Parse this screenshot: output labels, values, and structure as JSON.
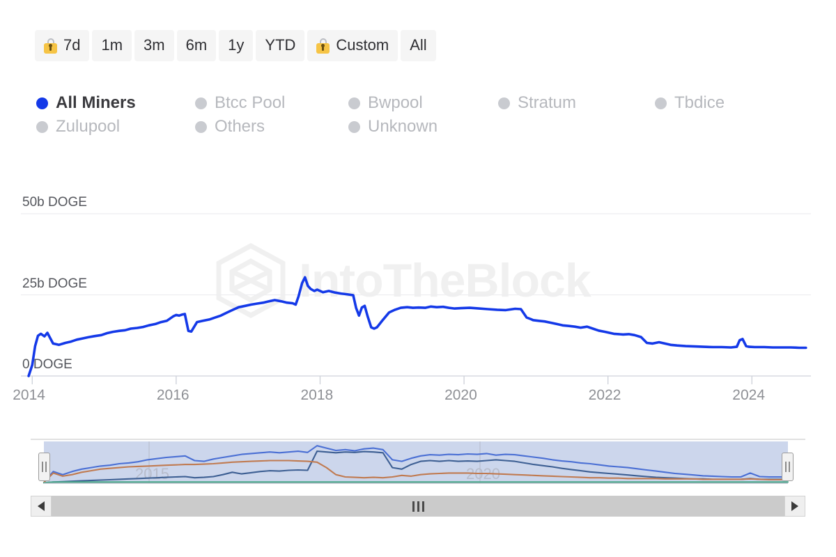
{
  "range_selector": {
    "buttons": [
      {
        "label": "7d",
        "locked": true,
        "name": "range-7d"
      },
      {
        "label": "1m",
        "locked": false,
        "name": "range-1m"
      },
      {
        "label": "3m",
        "locked": false,
        "name": "range-3m"
      },
      {
        "label": "6m",
        "locked": false,
        "name": "range-6m"
      },
      {
        "label": "1y",
        "locked": false,
        "name": "range-1y"
      },
      {
        "label": "YTD",
        "locked": false,
        "name": "range-ytd"
      },
      {
        "label": "Custom",
        "locked": true,
        "name": "range-custom"
      },
      {
        "label": "All",
        "locked": false,
        "name": "range-all"
      }
    ]
  },
  "legend": {
    "items": [
      {
        "label": "All Miners",
        "active": true,
        "color": "#1439e8"
      },
      {
        "label": "Btcc Pool",
        "active": false,
        "color": "#c9cbd0"
      },
      {
        "label": "Bwpool",
        "active": false,
        "color": "#c9cbd0"
      },
      {
        "label": "Stratum",
        "active": false,
        "color": "#c9cbd0"
      },
      {
        "label": "Tbdice",
        "active": false,
        "color": "#c9cbd0"
      },
      {
        "label": "Zulupool",
        "active": false,
        "color": "#c9cbd0"
      },
      {
        "label": "Others",
        "active": false,
        "color": "#c9cbd0"
      },
      {
        "label": "Unknown",
        "active": false,
        "color": "#c9cbd0"
      }
    ]
  },
  "watermark": {
    "text": "IntoTheBlock"
  },
  "navigator": {
    "year_labels": [
      "2015",
      "2020"
    ],
    "band_color": "#ccd6ec",
    "series_colors": [
      "#4a6fd4",
      "#3d5f93",
      "#c07a50",
      "#4aa98a"
    ]
  },
  "chart_data": {
    "type": "line",
    "title": "",
    "xlabel": "",
    "ylabel": "DOGE",
    "grid": true,
    "legend_position": "top",
    "ylim": [
      0,
      50
    ],
    "y_unit": "b DOGE",
    "y_ticks": [
      {
        "value": 0,
        "label": "0 DOGE"
      },
      {
        "value": 25,
        "label": "25b DOGE"
      },
      {
        "value": 50,
        "label": "50b DOGE"
      }
    ],
    "x_ticks": [
      "2014",
      "2016",
      "2018",
      "2020",
      "2022",
      "2024"
    ],
    "xlim": [
      "2013-12",
      "2024-10"
    ],
    "series": [
      {
        "name": "All Miners",
        "color": "#1439e8",
        "x": [
          2013.95,
          2014.0,
          2014.04,
          2014.08,
          2014.12,
          2014.17,
          2014.21,
          2014.29,
          2014.37,
          2014.46,
          2014.54,
          2014.62,
          2014.71,
          2014.79,
          2014.87,
          2014.96,
          2015.04,
          2015.12,
          2015.21,
          2015.29,
          2015.37,
          2015.46,
          2015.54,
          2015.62,
          2015.71,
          2015.79,
          2015.87,
          2015.96,
          2016.0,
          2016.04,
          2016.08,
          2016.12,
          2016.17,
          2016.21,
          2016.29,
          2016.37,
          2016.46,
          2016.54,
          2016.62,
          2016.71,
          2016.79,
          2016.87,
          2016.96,
          2017.04,
          2017.12,
          2017.21,
          2017.29,
          2017.37,
          2017.46,
          2017.54,
          2017.62,
          2017.66,
          2017.7,
          2017.75,
          2017.79,
          2017.83,
          2017.87,
          2017.92,
          2017.96,
          2018.04,
          2018.12,
          2018.21,
          2018.29,
          2018.37,
          2018.46,
          2018.5,
          2018.54,
          2018.58,
          2018.62,
          2018.66,
          2018.71,
          2018.75,
          2018.79,
          2018.87,
          2018.96,
          2019.04,
          2019.12,
          2019.21,
          2019.29,
          2019.37,
          2019.46,
          2019.54,
          2019.62,
          2019.71,
          2019.79,
          2019.87,
          2019.96,
          2020.08,
          2020.21,
          2020.33,
          2020.46,
          2020.58,
          2020.71,
          2020.79,
          2020.87,
          2020.92,
          2020.96,
          2021.04,
          2021.12,
          2021.21,
          2021.29,
          2021.37,
          2021.46,
          2021.54,
          2021.62,
          2021.71,
          2021.79,
          2021.87,
          2021.96,
          2022.08,
          2022.21,
          2022.29,
          2022.37,
          2022.46,
          2022.54,
          2022.62,
          2022.71,
          2022.79,
          2022.87,
          2022.96,
          2023.08,
          2023.21,
          2023.33,
          2023.46,
          2023.58,
          2023.71,
          2023.79,
          2023.83,
          2023.87,
          2023.92,
          2023.96,
          2024.04,
          2024.17,
          2024.29,
          2024.42,
          2024.54,
          2024.66,
          2024.75
        ],
        "y": [
          0.0,
          3.4,
          9.2,
          12.4,
          13.0,
          12.2,
          13.3,
          10.0,
          9.6,
          10.2,
          10.6,
          11.2,
          11.6,
          12.0,
          12.3,
          12.6,
          13.2,
          13.6,
          13.9,
          14.1,
          14.6,
          14.8,
          15.1,
          15.6,
          16.0,
          16.6,
          17.0,
          18.4,
          18.8,
          18.6,
          18.9,
          19.1,
          13.9,
          13.7,
          16.6,
          17.0,
          17.4,
          18.0,
          18.6,
          19.6,
          20.4,
          21.2,
          21.6,
          22.0,
          22.3,
          22.6,
          23.0,
          23.4,
          23.0,
          22.6,
          22.4,
          22.0,
          24.5,
          28.6,
          30.4,
          27.8,
          26.8,
          26.2,
          26.6,
          25.8,
          26.2,
          25.7,
          25.4,
          25.2,
          24.9,
          21.0,
          18.6,
          21.1,
          21.6,
          18.4,
          15.0,
          14.6,
          15.0,
          17.2,
          19.6,
          20.4,
          21.0,
          21.2,
          21.0,
          21.1,
          21.0,
          21.4,
          21.2,
          21.3,
          21.0,
          20.8,
          20.9,
          21.0,
          20.8,
          20.6,
          20.4,
          20.3,
          20.7,
          20.6,
          18.0,
          17.6,
          17.2,
          17.0,
          16.8,
          16.4,
          16.0,
          15.6,
          15.4,
          15.2,
          14.9,
          15.2,
          14.6,
          14.0,
          13.6,
          13.0,
          12.8,
          12.9,
          12.6,
          12.0,
          10.2,
          10.0,
          10.4,
          10.0,
          9.6,
          9.4,
          9.2,
          9.1,
          9.0,
          8.9,
          8.9,
          8.8,
          9.0,
          11.0,
          11.4,
          9.2,
          9.0,
          8.9,
          8.9,
          8.8,
          8.8,
          8.8,
          8.7,
          8.7
        ]
      }
    ]
  }
}
